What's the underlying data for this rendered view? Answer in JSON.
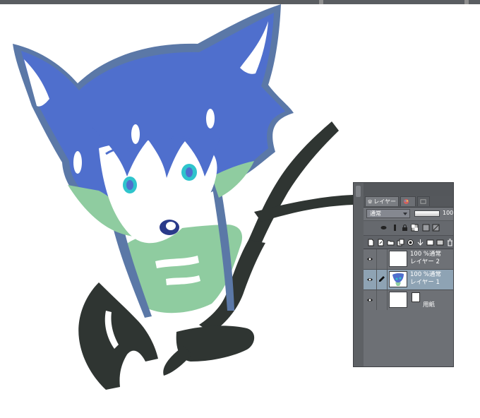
{
  "colors": {
    "hair_blue": "#4f6fcd",
    "outline_slate": "#5b78a7",
    "shirt_green": "#8fcca0",
    "tail_dark": "#2f3532",
    "eye_cyan": "#2fc4cc",
    "panel_bg": "#6b6e73",
    "selected_row": "#8ea3b4"
  },
  "layer_panel": {
    "tab_layer_label": "レイヤー",
    "blend_mode": "通常",
    "opacity_value": "100",
    "opacity_fraction": 1.0,
    "layers": [
      {
        "line1": "100 %通常",
        "line2": "レイヤー 2",
        "thumb": "transparent",
        "visible": true,
        "selected": false
      },
      {
        "line1": "100 %通常",
        "line2": "レイヤー 1",
        "thumb": "drawing",
        "visible": true,
        "selected": true
      },
      {
        "name": "用紙",
        "thumb": "white",
        "visible": true,
        "selected": false
      }
    ]
  },
  "icons": {
    "layer_tab": "layers-icon",
    "second_tab": "palette-icon",
    "third_tab": "navigator-icon",
    "eye": "eye-icon",
    "pen": "pen-edit-icon",
    "paper": "paper-icon"
  }
}
